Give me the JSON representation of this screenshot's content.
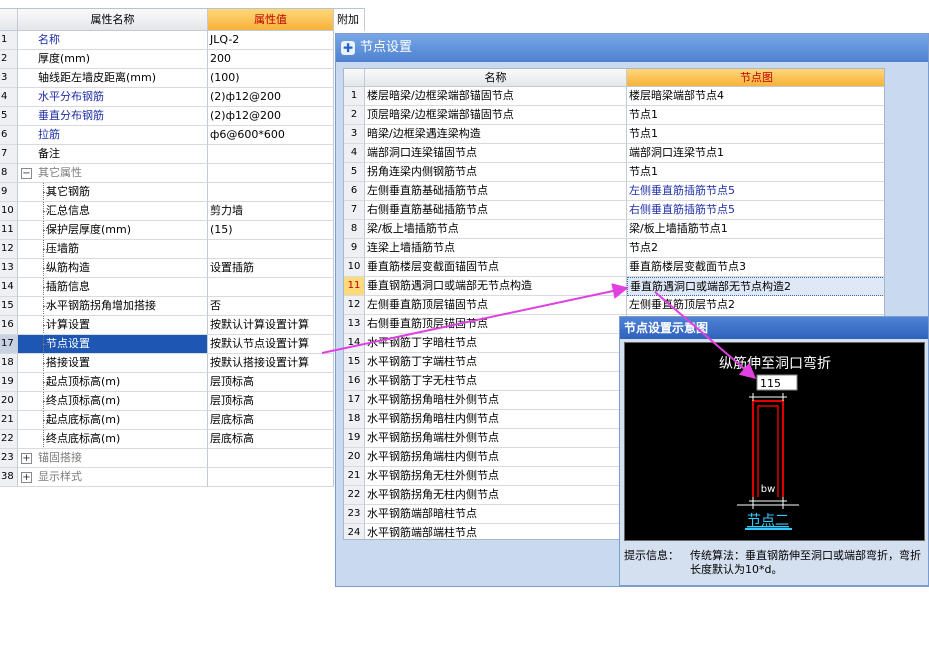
{
  "left_grid": {
    "header_name": "属性名称",
    "header_value": "属性值",
    "rows": [
      {
        "num": "1",
        "name": "名称",
        "value": "JLQ-2",
        "style": "blue"
      },
      {
        "num": "2",
        "name": "厚度(mm)",
        "value": "200",
        "style": ""
      },
      {
        "num": "3",
        "name": "轴线距左墙皮距离(mm)",
        "value": "(100)",
        "style": ""
      },
      {
        "num": "4",
        "name": "水平分布钢筋",
        "value": "(2)ф12@200",
        "style": "blue"
      },
      {
        "num": "5",
        "name": "垂直分布钢筋",
        "value": "(2)ф12@200",
        "style": "blue"
      },
      {
        "num": "6",
        "name": "拉筋",
        "value": "ф6@600*600",
        "style": "blue"
      },
      {
        "num": "7",
        "name": "备注",
        "value": "",
        "style": ""
      },
      {
        "num": "8",
        "name": "其它属性",
        "value": "",
        "style": "grey",
        "expander": "−"
      },
      {
        "num": "9",
        "name": "其它钢筋",
        "value": "",
        "style": "child"
      },
      {
        "num": "10",
        "name": "汇总信息",
        "value": "剪力墙",
        "style": "child"
      },
      {
        "num": "11",
        "name": "保护层厚度(mm)",
        "value": "(15)",
        "style": "child"
      },
      {
        "num": "12",
        "name": "压墙筋",
        "value": "",
        "style": "child"
      },
      {
        "num": "13",
        "name": "纵筋构造",
        "value": "设置插筋",
        "style": "child"
      },
      {
        "num": "14",
        "name": "插筋信息",
        "value": "",
        "style": "child"
      },
      {
        "num": "15",
        "name": "水平钢筋拐角增加搭接",
        "value": "否",
        "style": "child"
      },
      {
        "num": "16",
        "name": "计算设置",
        "value": "按默认计算设置计算",
        "style": "child"
      },
      {
        "num": "17",
        "name": "节点设置",
        "value": "按默认节点设置计算",
        "style": "child",
        "selected": true
      },
      {
        "num": "18",
        "name": "搭接设置",
        "value": "按默认搭接设置计算",
        "style": "child"
      },
      {
        "num": "19",
        "name": "起点顶标高(m)",
        "value": "层顶标高",
        "style": "child"
      },
      {
        "num": "20",
        "name": "终点顶标高(m)",
        "value": "层顶标高",
        "style": "child"
      },
      {
        "num": "21",
        "name": "起点底标高(m)",
        "value": "层底标高",
        "style": "child"
      },
      {
        "num": "22",
        "name": "终点底标高(m)",
        "value": "层底标高",
        "style": "child"
      },
      {
        "num": "23",
        "name": "锚固搭接",
        "value": "",
        "style": "grey",
        "expander": "+"
      },
      {
        "num": "38",
        "name": "显示样式",
        "value": "",
        "style": "grey",
        "expander": "+"
      }
    ]
  },
  "addon_label": "附加",
  "dialog": {
    "title": "节点设置",
    "header_name": "名称",
    "header_diagram": "节点图",
    "rows": [
      {
        "num": "1",
        "name": "楼层暗梁/边框梁端部锚固节点",
        "diagram": "楼层暗梁端部节点4"
      },
      {
        "num": "2",
        "name": "顶层暗梁/边框梁端部锚固节点",
        "diagram": "节点1"
      },
      {
        "num": "3",
        "name": "暗梁/边框梁遇连梁构造",
        "diagram": "节点1"
      },
      {
        "num": "4",
        "name": "端部洞口连梁锚固节点",
        "diagram": "端部洞口连梁节点1"
      },
      {
        "num": "5",
        "name": "拐角连梁内侧钢筋节点",
        "diagram": "节点1"
      },
      {
        "num": "6",
        "name": "左侧垂直筋基础插筋节点",
        "diagram": "左侧垂直筋插筋节点5",
        "blue": true
      },
      {
        "num": "7",
        "name": "右侧垂直筋基础插筋节点",
        "diagram": "右侧垂直筋插筋节点5",
        "blue": true
      },
      {
        "num": "8",
        "name": "梁/板上墙插筋节点",
        "diagram": "梁/板上墙插筋节点1"
      },
      {
        "num": "9",
        "name": "连梁上墙插筋节点",
        "diagram": "节点2"
      },
      {
        "num": "10",
        "name": "垂直筋楼层变截面锚固节点",
        "diagram": "垂直筋楼层变截面节点3"
      },
      {
        "num": "11",
        "name": "垂直钢筋遇洞口或端部无节点构造",
        "diagram": "垂直筋遇洞口或端部无节点构造2",
        "current": true
      },
      {
        "num": "12",
        "name": "左侧垂直筋顶层锚固节点",
        "diagram": "左侧垂直筋顶层节点2"
      },
      {
        "num": "13",
        "name": "右侧垂直筋顶层锚固节点",
        "diagram": ""
      },
      {
        "num": "14",
        "name": "水平钢筋丁字暗柱节点",
        "diagram": ""
      },
      {
        "num": "15",
        "name": "水平钢筋丁字端柱节点",
        "diagram": ""
      },
      {
        "num": "16",
        "name": "水平钢筋丁字无柱节点",
        "diagram": ""
      },
      {
        "num": "17",
        "name": "水平钢筋拐角暗柱外侧节点",
        "diagram": ""
      },
      {
        "num": "18",
        "name": "水平钢筋拐角暗柱内侧节点",
        "diagram": ""
      },
      {
        "num": "19",
        "name": "水平钢筋拐角端柱外侧节点",
        "diagram": ""
      },
      {
        "num": "20",
        "name": "水平钢筋拐角端柱内侧节点",
        "diagram": ""
      },
      {
        "num": "21",
        "name": "水平钢筋拐角无柱外侧节点",
        "diagram": ""
      },
      {
        "num": "22",
        "name": "水平钢筋拐角无柱内侧节点",
        "diagram": ""
      },
      {
        "num": "23",
        "name": "水平钢筋端部暗柱节点",
        "diagram": ""
      },
      {
        "num": "24",
        "name": "水平钢筋端部端柱节点",
        "diagram": ""
      }
    ]
  },
  "diagram_popup": {
    "title": "节点设置示意图",
    "caption_top": "纵筋伸至洞口弯折",
    "input_value": "115",
    "dim_label": "bw",
    "node_name": "节点二",
    "hint_label": "提示信息：",
    "hint_text": "传统算法：垂直钢筋伸至洞口或端部弯折，弯折长度默认为10*d。"
  },
  "colors": {
    "selection": "#1e56b3",
    "header_orange": "#f7b23a",
    "header_text_red": "#c00000",
    "link_blue": "#1f2fa8",
    "arrow_magenta": "#e040e0",
    "diagram_red": "#e00000",
    "node_label_cyan": "#33ccff"
  }
}
